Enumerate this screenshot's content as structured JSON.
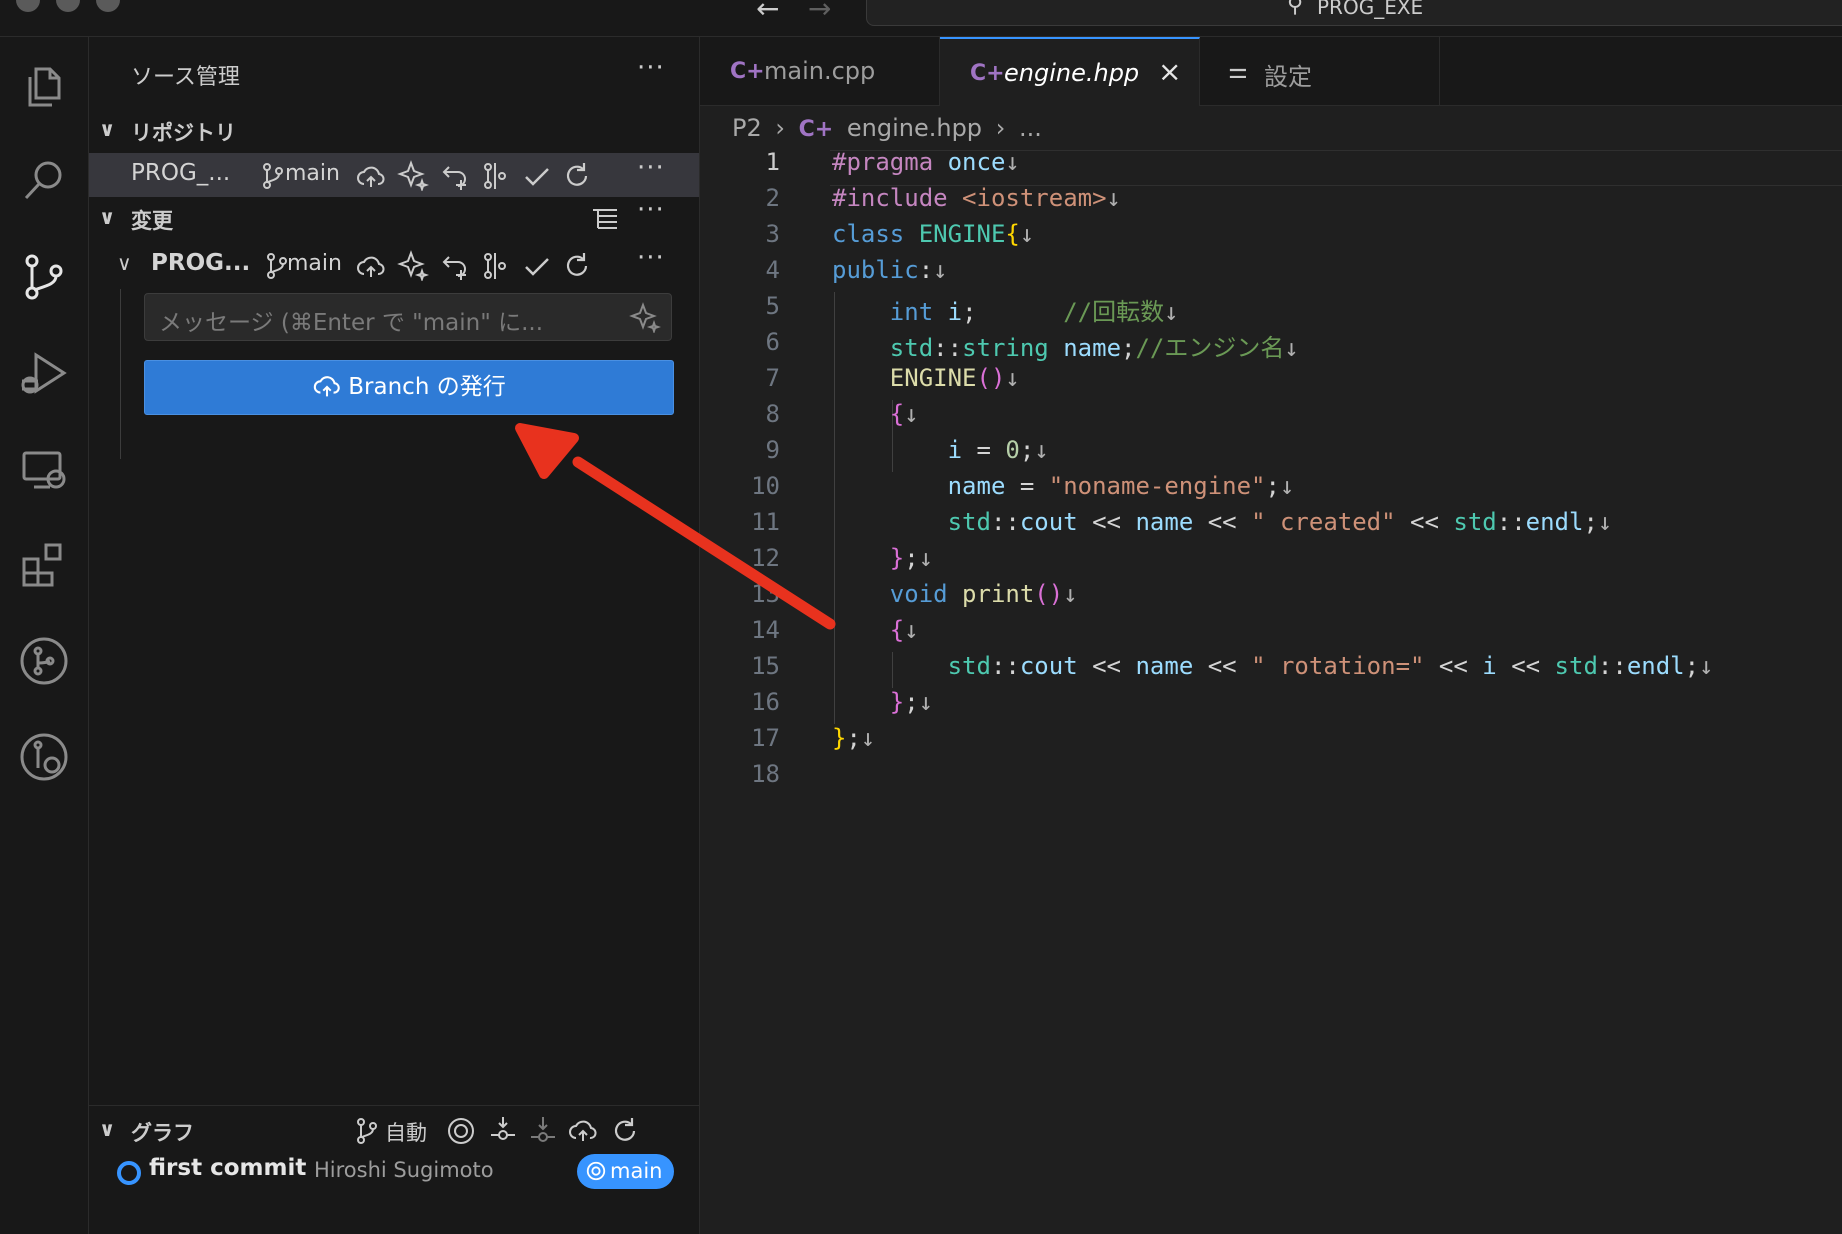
{
  "titlebar": {
    "search_text": "PROG_EXE"
  },
  "sidebar": {
    "title": "ソース管理",
    "repositories": {
      "header": "リポジトリ",
      "repo_name": "PROG_...",
      "branch": "main"
    },
    "changes": {
      "header": "変更",
      "repo_name": "PROG...",
      "branch": "main",
      "message_placeholder": "メッセージ (⌘Enter で \"main\" に...",
      "publish_button": "Branch の発行"
    },
    "graph": {
      "header": "グラフ",
      "mode": "自動",
      "commit_message": "first commit",
      "commit_author": "Hiroshi Sugimoto",
      "branch_badge": "main"
    }
  },
  "editor": {
    "tabs": [
      {
        "label": "main.cpp",
        "active": false
      },
      {
        "label": "engine.hpp",
        "active": true
      },
      {
        "label": "設定",
        "active": false
      }
    ],
    "breadcrumb": {
      "folder": "P2",
      "file": "engine.hpp",
      "more": "..."
    },
    "line_numbers": [
      "1",
      "2",
      "3",
      "4",
      "5",
      "6",
      "7",
      "8",
      "9",
      "10",
      "11",
      "12",
      "13",
      "14",
      "15",
      "16",
      "17",
      "18"
    ]
  },
  "colors": {
    "accent": "#3794ff",
    "publish_button": "#2f7bd6",
    "annotation_arrow": "#e8321e"
  }
}
